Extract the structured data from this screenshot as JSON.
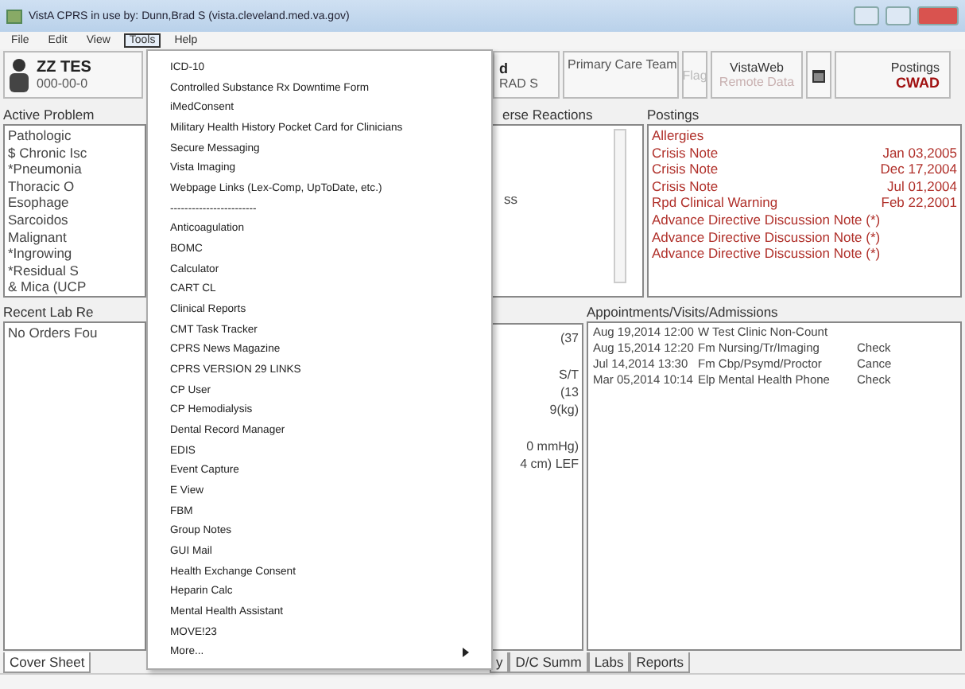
{
  "window": {
    "title": "VistA CPRS in use by: Dunn,Brad S  (vista.cleveland.med.va.gov)"
  },
  "menubar": [
    {
      "label": "File",
      "selected": false
    },
    {
      "label": "Edit",
      "selected": false
    },
    {
      "label": "View",
      "selected": false
    },
    {
      "label": "Tools",
      "selected": true
    },
    {
      "label": "Help",
      "selected": false
    }
  ],
  "patient": {
    "name": "ZZ TES",
    "ssn": "000-00-0"
  },
  "provider": {
    "name": "d",
    "line_2": "RAD S"
  },
  "primary_care": {
    "label": "Primary Care Team"
  },
  "flag": {
    "label": "Flag",
    "disabled": true
  },
  "vistaweb": {
    "label": "VistaWeb",
    "sub": "Remote Data",
    "sub_disabled": true
  },
  "postings_button": {
    "label": "Postings",
    "code": "CWAD"
  },
  "problems": {
    "title": "Active Problem",
    "items": [
      "Pathologic",
      "$  Chronic Isc",
      "*Pneumonia",
      "Thoracic O",
      "Esophage",
      "Sarcoidos",
      "Malignant",
      "*Ingrowing",
      "*Residual S",
      "&  Mica (UCP"
    ]
  },
  "labs": {
    "title": "Recent Lab Re",
    "items": [
      "No Orders Fou"
    ]
  },
  "reactions": {
    "title": "erse Reactions",
    "items": [
      "ss"
    ]
  },
  "vitals": {
    "groups": [
      [
        "(37"
      ],
      [
        "S/T",
        "(13",
        "9(kg)"
      ],
      [
        "0 mmHg)",
        "4 cm) LEF"
      ]
    ]
  },
  "postings": {
    "title": "Postings",
    "items": [
      {
        "name": "Allergies"
      },
      {
        "name": "Crisis Note",
        "date": "Jan 03,2005"
      },
      {
        "name": "Crisis Note",
        "date": "Dec 17,2004"
      },
      {
        "name": "Crisis Note",
        "date": "Jul 01,2004"
      },
      {
        "name": "Rpd Clinical Warning",
        "date": "Feb 22,2001"
      },
      {
        "name": "Advance Directive Discussion Note (*)"
      },
      {
        "name": "Advance Directive Discussion Note (*)"
      },
      {
        "name": "Advance Directive Discussion Note (*)"
      }
    ]
  },
  "appointments": {
    "title": "Appointments/Visits/Admissions",
    "rows": [
      {
        "date": "Aug 19,2014 12:00",
        "location": "W Test Clinic  Non-Count"
      },
      {
        "date": "Aug 15,2014 12:20",
        "location": "Fm Nursing/Tr/Imaging",
        "status": "Check"
      },
      {
        "date": "Jul 14,2014 13:30",
        "location": "Fm Cbp/Psymd/Proctor",
        "status": "Cance"
      },
      {
        "date": "Mar 05,2014 10:14",
        "location": "Elp Mental Health Phone",
        "status": "Check"
      }
    ]
  },
  "tabs": [
    {
      "label": "Cover Sheet",
      "selected": true
    },
    {
      "label": "y",
      "selected": false
    },
    {
      "label": "D/C Summ",
      "selected": false
    },
    {
      "label": "Labs",
      "selected": false
    },
    {
      "label": "Reports",
      "selected": false
    }
  ],
  "tools_menu": [
    {
      "label": "ICD-10"
    },
    {
      "label": "Controlled Substance Rx Downtime Form"
    },
    {
      "label": "iMedConsent"
    },
    {
      "label": "Military Health History Pocket Card for Clinicians"
    },
    {
      "label": "Secure Messaging"
    },
    {
      "label": "Vista Imaging"
    },
    {
      "label": "Webpage Links (Lex-Comp, UpToDate, etc.)"
    },
    {
      "label": "------------------------"
    },
    {
      "label": "Anticoagulation"
    },
    {
      "label": "BOMC"
    },
    {
      "label": "Calculator"
    },
    {
      "label": "CART CL"
    },
    {
      "label": "Clinical Reports"
    },
    {
      "label": "CMT Task Tracker"
    },
    {
      "label": "CPRS News Magazine"
    },
    {
      "label": "CPRS VERSION 29 LINKS"
    },
    {
      "label": "CP User"
    },
    {
      "label": "CP Hemodialysis"
    },
    {
      "label": "Dental Record Manager"
    },
    {
      "label": "EDIS"
    },
    {
      "label": "Event Capture"
    },
    {
      "label": "E View"
    },
    {
      "label": "FBM"
    },
    {
      "label": "Group Notes"
    },
    {
      "label": "GUI Mail"
    },
    {
      "label": "Health Exchange Consent"
    },
    {
      "label": "Heparin Calc"
    },
    {
      "label": "Mental Health Assistant"
    },
    {
      "label": "MOVE!23"
    },
    {
      "label": "More...",
      "submenu": true
    }
  ]
}
